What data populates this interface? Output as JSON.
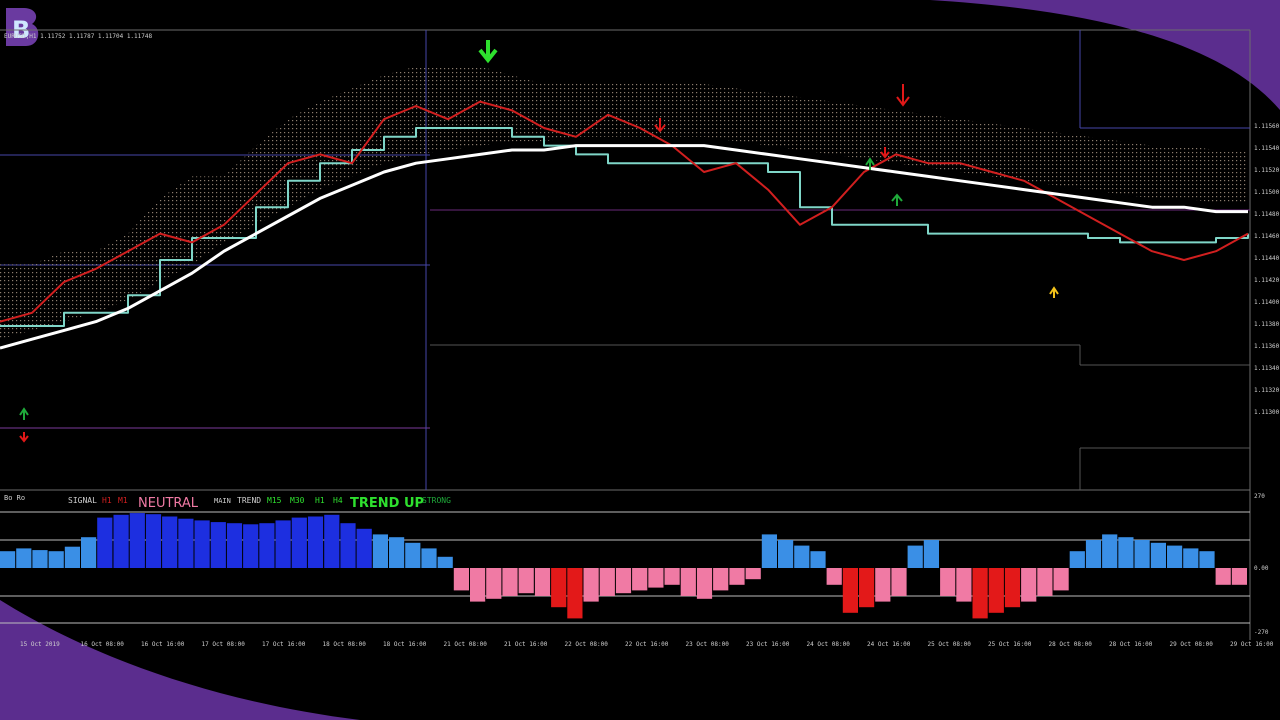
{
  "logo": {
    "letter": "B",
    "color": "#6a3aa0"
  },
  "header": {
    "symbol_quote": "EURUSD,H1 1.11752 1.11787 1.11704 1.11748"
  },
  "colors": {
    "background": "#000000",
    "frame_purple": "#5b2d8e",
    "price_red": "#d11f1f",
    "kijun_teal": "#7fd6c8",
    "moving_average": "#ffffff",
    "cloud": "#9a8a7a",
    "hist_up": "#3a8fe6",
    "hist_up_strong": "#1d2fe0",
    "hist_down": "#f07aa4",
    "hist_down_strong": "#e31919",
    "arrow_down_green": "#2ee02e",
    "arrow_down_red": "#e01818",
    "arrow_up_green": "#1faa3a",
    "arrow_up_yellow": "#f2c21a"
  },
  "indicator_panel": {
    "title": "Bo Ro",
    "signal_label": "SIGNAL",
    "signal_tfs": [
      "H1",
      "M1"
    ],
    "signal_state": "NEUTRAL",
    "main_label": "MAIN",
    "trend_label": "TREND",
    "trend_tfs": [
      "M15",
      "M30",
      "H1",
      "H4"
    ],
    "trend_state": "TREND UP",
    "strength": "STRONG",
    "levels": [
      "270",
      "0.00",
      "-270"
    ]
  },
  "chart_data": {
    "type": "line",
    "title": "",
    "price_axis": [
      "1.11560",
      "1.11540",
      "1.11520",
      "1.11500",
      "1.11480",
      "1.11460",
      "1.11440",
      "1.11420",
      "1.11400",
      "1.11380",
      "1.11360",
      "1.11340",
      "1.11320",
      "1.11300"
    ],
    "time_axis": [
      "15 Oct 2019",
      "16 Oct 08:00",
      "16 Oct 16:00",
      "17 Oct 08:00",
      "17 Oct 16:00",
      "18 Oct 08:00",
      "18 Oct 16:00",
      "21 Oct 08:00",
      "21 Oct 16:00",
      "22 Oct 08:00",
      "22 Oct 16:00",
      "23 Oct 08:00",
      "23 Oct 16:00",
      "24 Oct 08:00",
      "24 Oct 16:00",
      "25 Oct 08:00",
      "25 Oct 16:00",
      "28 Oct 08:00",
      "28 Oct 16:00",
      "29 Oct 08:00",
      "29 Oct 16:00"
    ],
    "series": [
      {
        "key": "price",
        "values": [
          0.36,
          0.38,
          0.45,
          0.48,
          0.52,
          0.56,
          0.54,
          0.58,
          0.65,
          0.72,
          0.74,
          0.72,
          0.82,
          0.85,
          0.82,
          0.86,
          0.84,
          0.8,
          0.78,
          0.83,
          0.8,
          0.76,
          0.7,
          0.72,
          0.66,
          0.58,
          0.62,
          0.7,
          0.74,
          0.72,
          0.72,
          0.7,
          0.68,
          0.64,
          0.6,
          0.56,
          0.52,
          0.5,
          0.52,
          0.56
        ]
      },
      {
        "key": "kijun",
        "values": [
          0.35,
          0.35,
          0.38,
          0.38,
          0.42,
          0.5,
          0.55,
          0.55,
          0.62,
          0.68,
          0.72,
          0.75,
          0.78,
          0.8,
          0.8,
          0.8,
          0.78,
          0.76,
          0.74,
          0.72,
          0.72,
          0.72,
          0.72,
          0.72,
          0.7,
          0.62,
          0.58,
          0.58,
          0.58,
          0.56,
          0.56,
          0.56,
          0.56,
          0.56,
          0.55,
          0.54,
          0.54,
          0.54,
          0.55,
          0.56
        ]
      },
      {
        "key": "ma",
        "values": [
          0.3,
          0.32,
          0.34,
          0.36,
          0.39,
          0.43,
          0.47,
          0.52,
          0.56,
          0.6,
          0.64,
          0.67,
          0.7,
          0.72,
          0.73,
          0.74,
          0.75,
          0.75,
          0.76,
          0.76,
          0.76,
          0.76,
          0.76,
          0.75,
          0.74,
          0.73,
          0.72,
          0.71,
          0.7,
          0.69,
          0.68,
          0.67,
          0.66,
          0.65,
          0.64,
          0.63,
          0.62,
          0.62,
          0.61,
          0.61
        ]
      }
    ],
    "histogram": [
      0.3,
      0.35,
      0.32,
      0.3,
      0.38,
      0.55,
      0.9,
      0.95,
      0.98,
      0.96,
      0.92,
      0.88,
      0.85,
      0.82,
      0.8,
      0.78,
      0.8,
      0.85,
      0.9,
      0.92,
      0.95,
      0.8,
      0.7,
      0.6,
      0.55,
      0.45,
      0.35,
      0.2,
      -0.4,
      -0.6,
      -0.55,
      -0.5,
      -0.45,
      -0.5,
      -0.7,
      -0.9,
      -0.6,
      -0.5,
      -0.45,
      -0.4,
      -0.35,
      -0.3,
      -0.5,
      -0.55,
      -0.4,
      -0.3,
      -0.2,
      0.6,
      0.5,
      0.4,
      0.3,
      -0.3,
      -0.8,
      -0.7,
      -0.6,
      -0.5,
      0.4,
      0.5,
      -0.5,
      -0.6,
      -0.9,
      -0.8,
      -0.7,
      -0.6,
      -0.5,
      -0.4,
      0.3,
      0.5,
      0.6,
      0.55,
      0.5,
      0.45,
      0.4,
      0.35,
      0.3,
      -0.3,
      -0.3
    ],
    "grid": false,
    "legend": "none"
  }
}
